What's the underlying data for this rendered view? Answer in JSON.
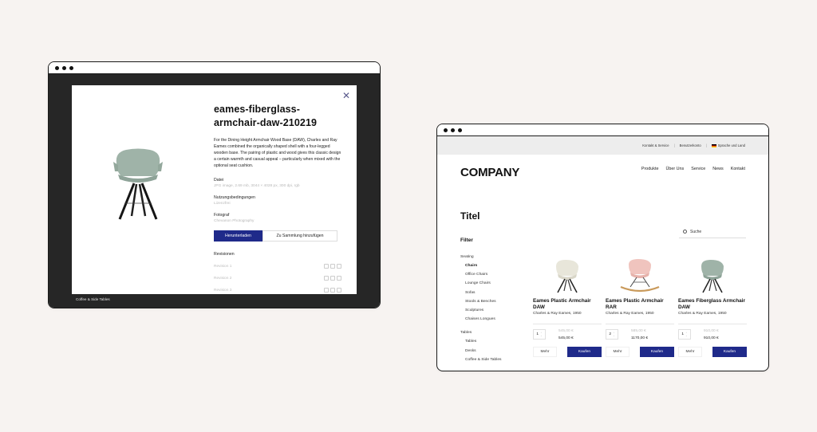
{
  "colors": {
    "accent": "#1f2a8a",
    "background": "#f7f3f1",
    "dark_stage": "#262626",
    "topbar": "#ededed"
  },
  "left_window": {
    "modal": {
      "title": "eames-fiberglass-armchair-daw-210219",
      "description": "For the Dining Height Armchair Wood Base (DAW), Charles and Ray Eames combined the organically shaped shell with a four-legged wooden base. The pairing of plastic and wood gives this classic design a certain warmth and casual appeal – particularly when mixed with the optional seat cushion.",
      "meta": [
        {
          "label": "Datei",
          "value": "JPG image, 2.69 mb, 3044 × 4028 px, 300 dpi, rgb"
        },
        {
          "label": "Nutzungsbedingungen",
          "value": "Lizenzfrei"
        },
        {
          "label": "Fotograf",
          "value": "Chevanon Photography"
        }
      ],
      "download_label": "Herunterladen",
      "add_collection_label": "Zu Sammlung hinzufügen",
      "revisions_title": "Revisionen",
      "revisions": [
        "Revision 1",
        "Revision 2",
        "Revision 3"
      ],
      "close_icon": "close-icon"
    },
    "footer_caption": "Coffee & Side Tables"
  },
  "right_window": {
    "topbar": {
      "links": [
        "Kontakt & Service",
        "Benutzerkonto",
        "Sprache und Land"
      ]
    },
    "logo": "COMPANY",
    "nav": [
      "Produkte",
      "Über Uns",
      "Service",
      "News",
      "Kontakt"
    ],
    "page_title": "Titel",
    "filter_title": "Filter",
    "search_label": "Suche",
    "filters": {
      "group1": "Seating",
      "group1_items": [
        "Chairs",
        "Office Chairs",
        "Lounge Chairs",
        "Sofas",
        "Stools & Benches",
        "Sculptures",
        "Chaises Longues"
      ],
      "group2": "Tables",
      "group2_items": [
        "Tables",
        "Desks",
        "Coffee & Side Tables"
      ]
    },
    "products": [
      {
        "name": "Eames Plastic Armchair DAW",
        "maker": "Charles & Ray Eames, 1950",
        "qty": "1",
        "old_price": "545,00 €",
        "price": "545,00 €",
        "more": "Mehr",
        "buy": "Kaufen",
        "color": "#e8e6da"
      },
      {
        "name": "Eames Plastic Armchair RAR",
        "maker": "Charles & Ray Eames, 1950",
        "qty": "2",
        "old_price": "585,00 €",
        "price": "1170,00 €",
        "more": "Mehr",
        "buy": "Kaufen",
        "color": "#f0c4be"
      },
      {
        "name": "Eames Fiberglass Armchair DAW",
        "maker": "Charles & Ray Eames, 1950",
        "qty": "1",
        "old_price": "910,00 €",
        "price": "910,00 €",
        "more": "Mehr",
        "buy": "Kaufen",
        "color": "#9fb3a8"
      }
    ]
  }
}
